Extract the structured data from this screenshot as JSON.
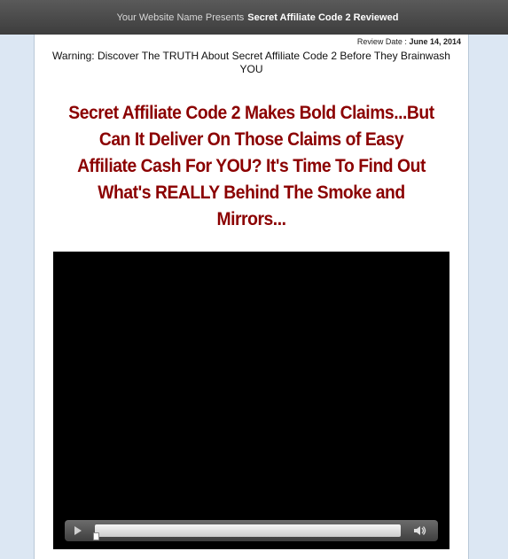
{
  "topbar": {
    "presents_text": "Your Website Name Presents",
    "title": "Secret Affiliate Code 2 Reviewed"
  },
  "review": {
    "label": "Review Date :",
    "date": "June 14, 2014"
  },
  "warning": "Warning: Discover The TRUTH About Secret Affiliate Code 2 Before They Brainwash YOU",
  "headline": "Secret Affiliate Code 2 Makes Bold Claims...But Can It Deliver On Those Claims of Easy Affiliate Cash For YOU? It's Time To Find Out What's REALLY Behind The Smoke and Mirrors...",
  "video": {
    "icons": [
      "play-icon",
      "volume-icon"
    ],
    "progress": 0
  },
  "colors": {
    "headline": "#8b0000",
    "topbar": "#4a4a4a",
    "background": "#dde8f4"
  }
}
